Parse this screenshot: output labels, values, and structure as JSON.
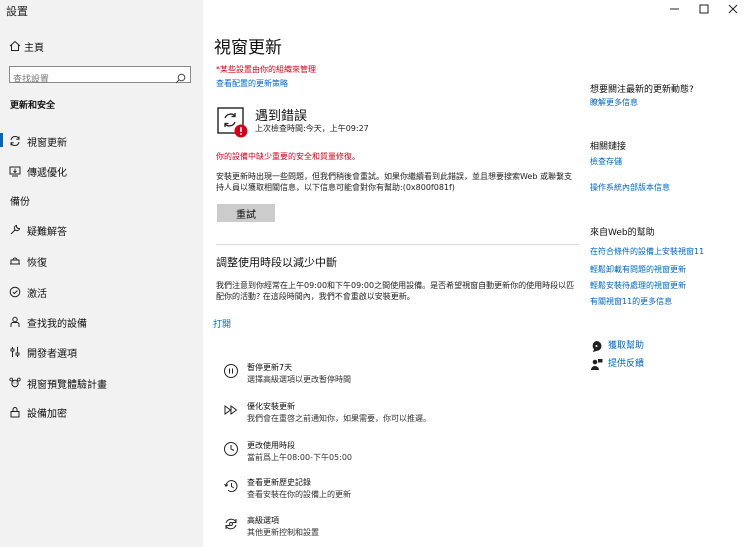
{
  "window": {
    "title": "設置",
    "controls": [
      "minimize",
      "maximize",
      "close"
    ]
  },
  "sidebar": {
    "home": "主頁",
    "search_placeholder": "查找設置",
    "section": "更新和安全",
    "items": [
      {
        "label": "視窗更新",
        "icon": "refresh-icon",
        "active": true
      },
      {
        "label": "傳遞優化",
        "icon": "delivery-icon"
      },
      {
        "label": "備份",
        "icon": "backup-icon"
      },
      {
        "label": "疑難解答",
        "icon": "wrench-icon"
      },
      {
        "label": "恢復",
        "icon": "recovery-icon"
      },
      {
        "label": "激活",
        "icon": "activation-icon"
      },
      {
        "label": "查找我的設備",
        "icon": "person-icon"
      },
      {
        "label": "開發者選項",
        "icon": "developer-icon"
      },
      {
        "label": "視窗預覽體驗計畫",
        "icon": "insider-icon"
      },
      {
        "label": "設備加密",
        "icon": "lock-icon"
      }
    ]
  },
  "main": {
    "title": "視窗更新",
    "managed_notice": "*某些設置由你的組織來管理",
    "policy_link": "查看配置的更新策略",
    "status_title": "遇到錯誤",
    "last_check": "上次檢查時間:今天，上午09:27",
    "warning": "你的設備中缺少重要的安全和質量修復。",
    "error_text": "安裝更新時出現一些問題，但我們稍後會重試。如果你繼續看到此錯誤，並且想要搜索Web 或聯繫支持人員以獲取相關信息，以下信息可能會對你有幫助:(0x800f081f)",
    "retry_label": "重試",
    "active_hours_heading": "調整使用時段以減少中斷",
    "active_hours_text": "我們注意到你經常在上午09:00和下午09:00之間使用設備。是否希望視窗自動更新你的使用時段以匹配你的活動? 在這段時間內，我們不會重啟以安裝更新。",
    "turn_on": "打開",
    "options": [
      {
        "title": "暫停更新7天",
        "desc": "選擇高級選項以更改暫停時間",
        "icon": "pause-icon"
      },
      {
        "title": "優化安裝更新",
        "desc": "我們會在重啓之前通知你，如果需要，你可以推遲。",
        "icon": "fast-forward-icon"
      },
      {
        "title": "更改使用時段",
        "desc": "當前爲上午08:00-下午05:00",
        "icon": "clock-icon"
      },
      {
        "title": "查看更新歷史記錄",
        "desc": "查看安裝在你的設備上的更新",
        "icon": "history-icon"
      },
      {
        "title": "高級選項",
        "desc": "其他更新控制和設置",
        "icon": "advanced-icon"
      }
    ]
  },
  "right_panel": {
    "q_heading": "想要關注最新的更新動態?",
    "q_link": "瞭解更多信息",
    "related_heading": "相關鏈接",
    "related_links": [
      "檢查存儲",
      "操作系統內部版本信息"
    ],
    "web_heading": "來自Web的幫助",
    "web_links": [
      "在符合條件的設備上安裝視窗11",
      "輕鬆卸載有問題的視窗更新",
      "輕鬆安裝待處理的視窗更新",
      "有關視窗11的更多信息"
    ],
    "help_link": "獲取幫助",
    "feedback_link": "提供反饋"
  },
  "colors": {
    "accent": "#0067c0",
    "error": "#d0021b",
    "sidebar_bg": "#f2f2f2"
  }
}
